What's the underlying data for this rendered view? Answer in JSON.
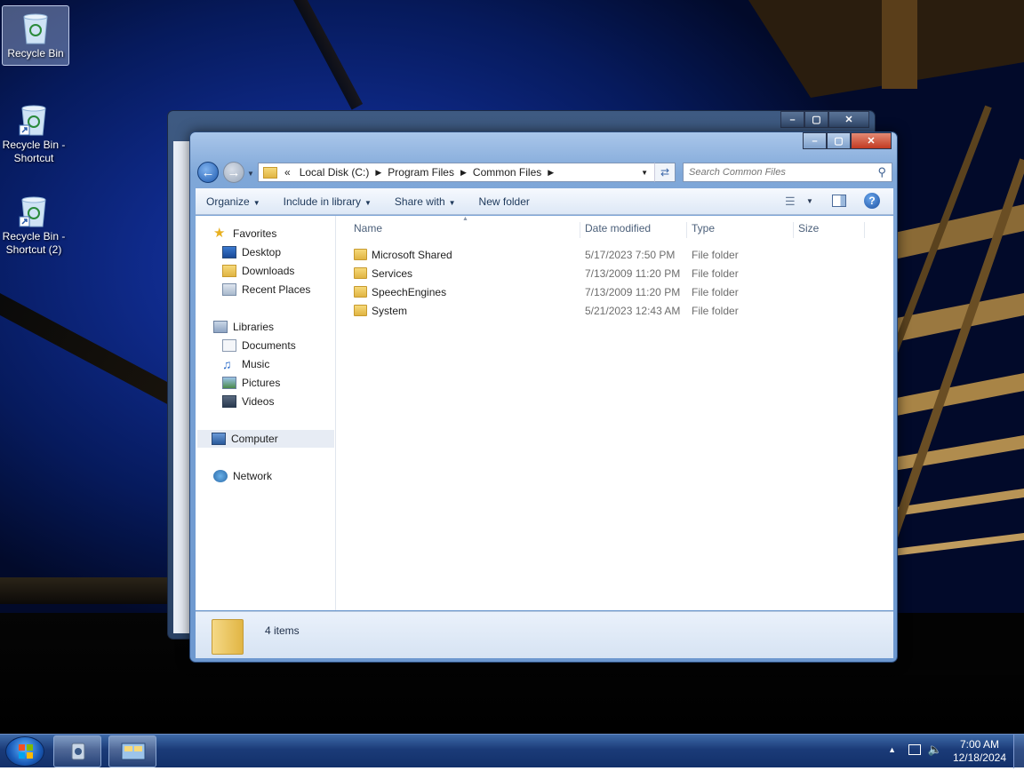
{
  "desktop": {
    "icons": [
      {
        "label": "Recycle Bin",
        "selected": true
      },
      {
        "label": "Recycle Bin - Shortcut",
        "selected": false
      },
      {
        "label": "Recycle Bin - Shortcut (2)",
        "selected": false
      }
    ]
  },
  "explorer": {
    "address": {
      "overflow": "«",
      "crumbs": [
        "Local Disk (C:)",
        "Program Files",
        "Common Files"
      ]
    },
    "search_placeholder": "Search Common Files",
    "toolbar": {
      "organize": "Organize",
      "include_in_library": "Include in library",
      "share_with": "Share with",
      "new_folder": "New folder"
    },
    "nav": {
      "favorites": "Favorites",
      "desktop": "Desktop",
      "downloads": "Downloads",
      "recent_places": "Recent Places",
      "libraries": "Libraries",
      "documents": "Documents",
      "music": "Music",
      "pictures": "Pictures",
      "videos": "Videos",
      "computer": "Computer",
      "network": "Network"
    },
    "columns": {
      "name": "Name",
      "date": "Date modified",
      "type": "Type",
      "size": "Size"
    },
    "files": [
      {
        "name": "Microsoft Shared",
        "date": "5/17/2023 7:50 PM",
        "type": "File folder"
      },
      {
        "name": "Services",
        "date": "7/13/2009 11:20 PM",
        "type": "File folder"
      },
      {
        "name": "SpeechEngines",
        "date": "7/13/2009 11:20 PM",
        "type": "File folder"
      },
      {
        "name": "System",
        "date": "5/21/2023 12:43 AM",
        "type": "File folder"
      }
    ],
    "status": "4 items"
  },
  "taskbar": {
    "time": "7:00 AM",
    "date": "12/18/2024"
  }
}
